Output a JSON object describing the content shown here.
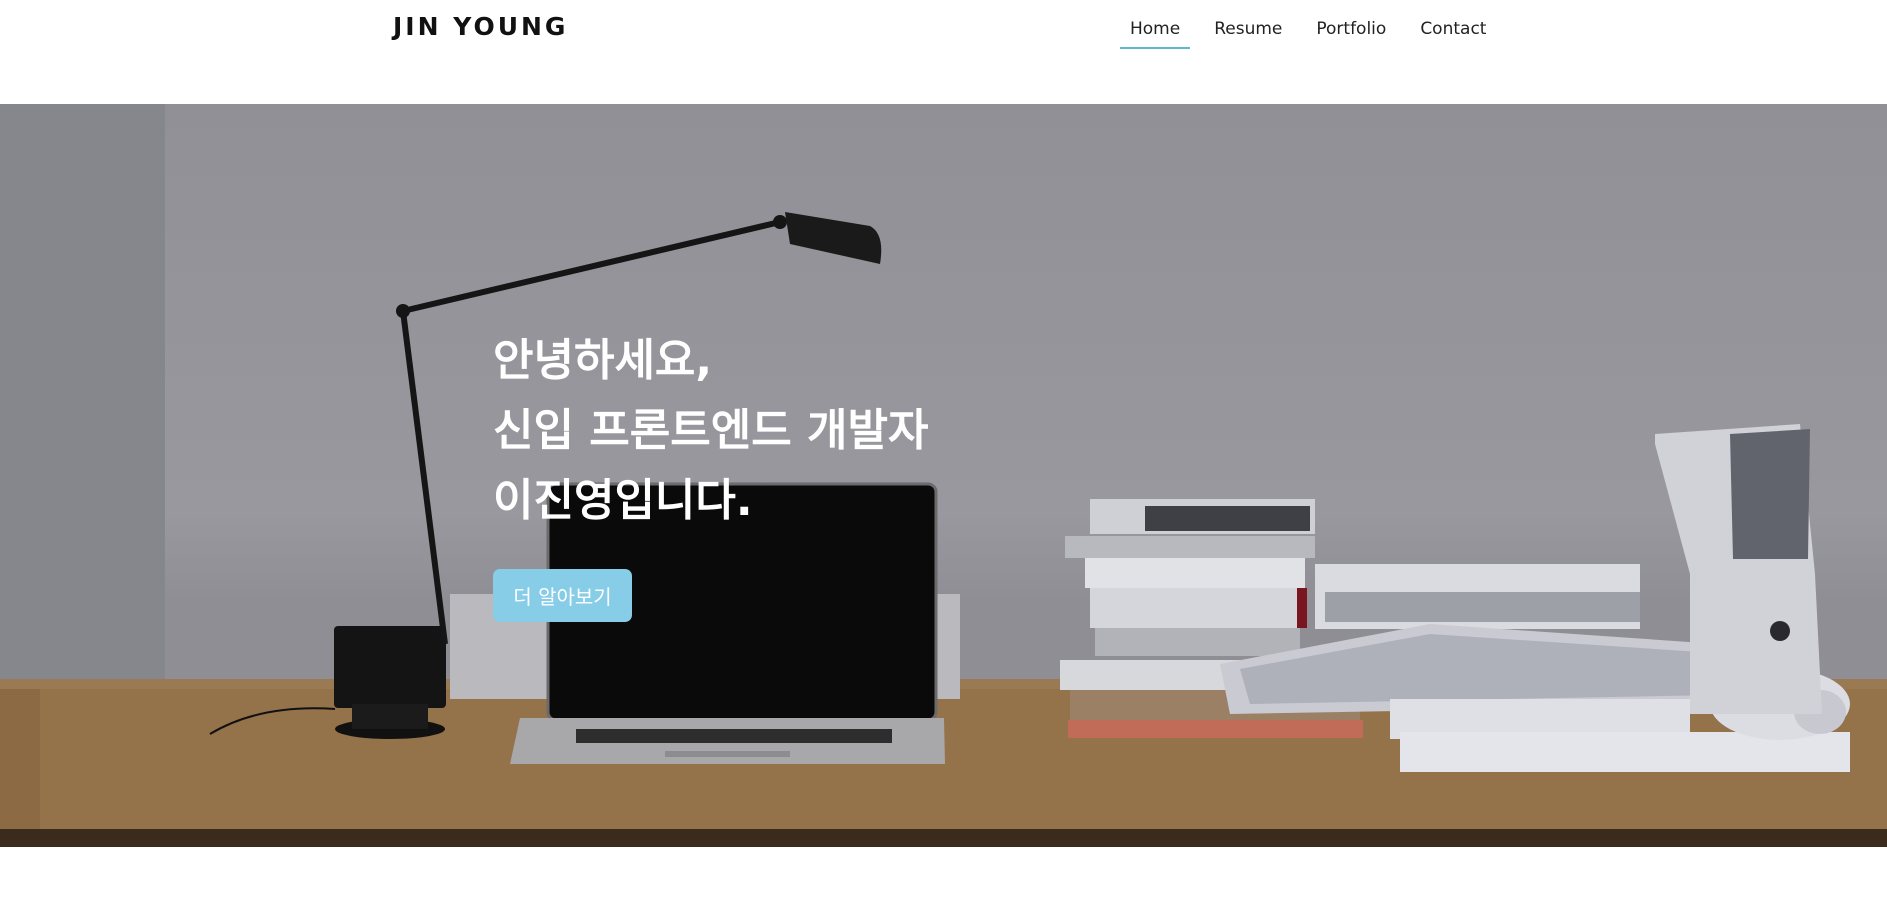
{
  "header": {
    "logo": "JIN YOUNG",
    "nav": [
      {
        "label": "Home",
        "active": true
      },
      {
        "label": "Resume",
        "active": false
      },
      {
        "label": "Portfolio",
        "active": false
      },
      {
        "label": "Contact",
        "active": false
      }
    ]
  },
  "hero": {
    "title_lines": [
      "안녕하세요,",
      "신입 프론트엔드 개발자",
      "이진영입니다."
    ],
    "cta_label": "더 알아보기"
  },
  "colors": {
    "accent": "#5fb8cf",
    "cta_bg": "#87cde8",
    "hero_text": "#ffffff"
  }
}
